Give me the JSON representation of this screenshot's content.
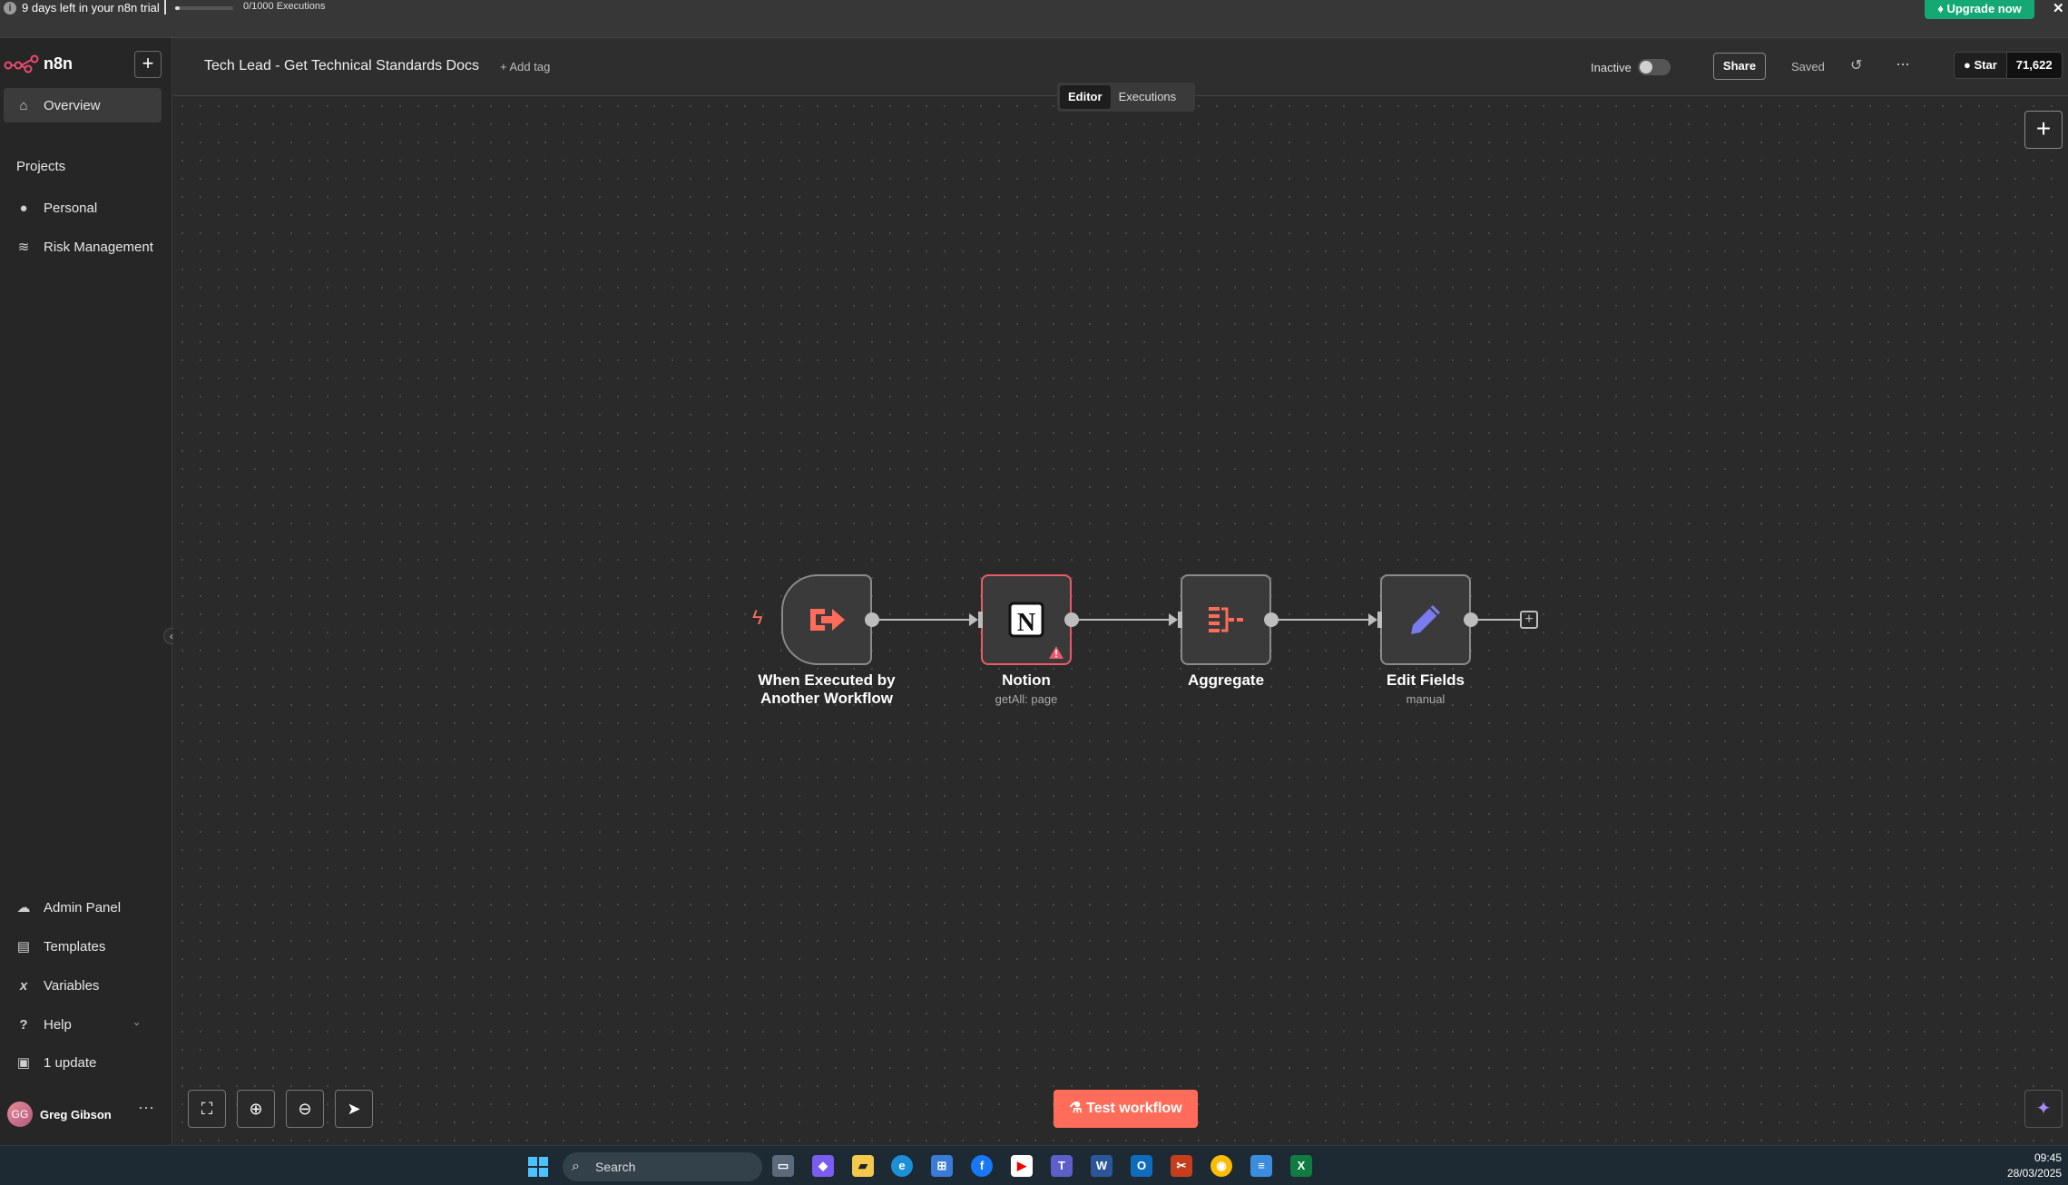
{
  "banner": {
    "trial_text": "9 days left in your n8n trial",
    "executions_text": "0/1000 Executions",
    "executions_used": 0,
    "executions_limit": 1000,
    "upgrade_label": "Upgrade now",
    "close_glyph": "✕"
  },
  "sidebar": {
    "logo_text": "n8n",
    "new_glyph": "+",
    "overview_label": "Overview",
    "projects_label": "Projects",
    "projects": [
      {
        "label": "Personal",
        "icon": "user-icon"
      },
      {
        "label": "Risk Management",
        "icon": "layers-icon"
      }
    ],
    "bottom_items": [
      {
        "label": "Admin Panel",
        "icon": "cloud-icon"
      },
      {
        "label": "Templates",
        "icon": "template-icon"
      },
      {
        "label": "Variables",
        "icon": "variable-icon"
      },
      {
        "label": "Help",
        "icon": "help-icon"
      },
      {
        "label": "1 update",
        "icon": "gift-icon"
      }
    ],
    "user": {
      "initials": "GG",
      "name": "Greg Gibson"
    }
  },
  "header": {
    "workflow_name": "Tech Lead - Get Technical Standards Docs",
    "add_tag": "+ Add tag",
    "status_label": "Inactive",
    "share_label": "Share",
    "saved_label": "Saved",
    "github_star_label": "Star",
    "github_star_count": "71,622"
  },
  "tabs": {
    "editor": "Editor",
    "executions": "Executions",
    "active": "editor"
  },
  "workflow": {
    "nodes": [
      {
        "name": "When Executed by Another Workflow",
        "line1": "When Executed by",
        "line2": "Another Workflow",
        "subtitle": "",
        "icon": "execute-workflow-trigger-icon"
      },
      {
        "name": "Notion",
        "subtitle": "getAll: page",
        "icon": "notion-icon",
        "warning": true
      },
      {
        "name": "Aggregate",
        "subtitle": "",
        "icon": "aggregate-icon"
      },
      {
        "name": "Edit Fields",
        "subtitle": "manual",
        "icon": "pencil-icon"
      }
    ]
  },
  "canvas": {
    "test_workflow_label": "Test workflow"
  },
  "taskbar": {
    "search_placeholder": "Search",
    "time": "09:45",
    "date": "28/03/2025"
  },
  "colors": {
    "accent": "#ff6d5a",
    "upgrade": "#13a874",
    "error_border": "#ea5a68",
    "edit_fields_icon": "#7b7bf0"
  }
}
